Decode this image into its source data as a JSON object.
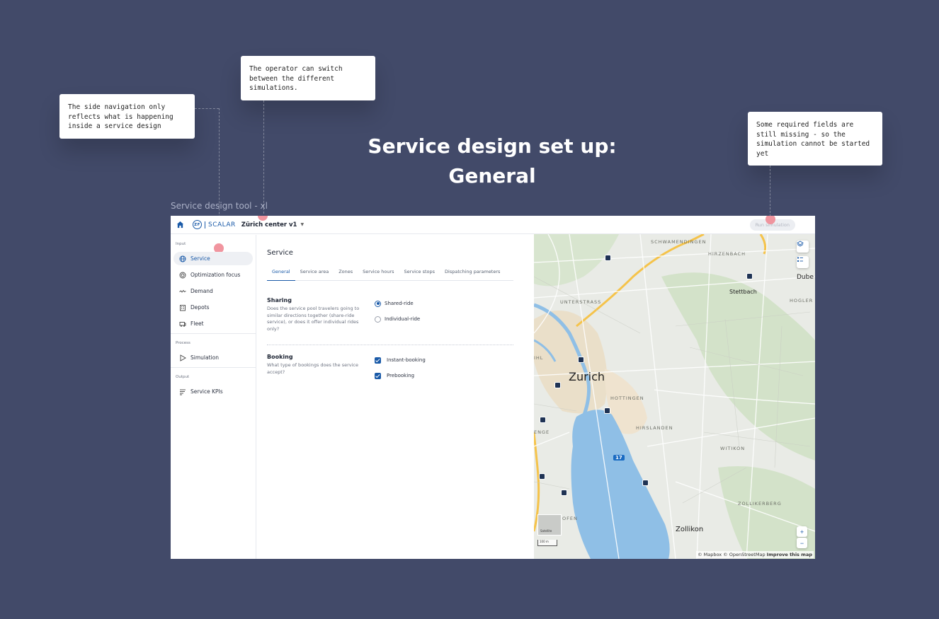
{
  "page": {
    "title_line1": "Service design set up:",
    "title_line2": "General",
    "frame_label": "Service design tool - xl"
  },
  "annotations": {
    "side_nav": "The side navigation only\nreflects what is happening\ninside a service design",
    "switch_sim": "The operator can switch\nbetween the different\nsimulations.",
    "required_fields": "Some required fields are\nstill missing - so the\nsimulation cannot be started\nyet"
  },
  "topbar": {
    "brand_zf": "ZF",
    "brand_name": "SCALAR",
    "simulation_name": "Zürich center v1",
    "run_button": "Run simulation"
  },
  "sidenav": {
    "input_label": "Input",
    "input_items": [
      {
        "label": "Service",
        "icon": "globe-icon"
      },
      {
        "label": "Optimization focus",
        "icon": "target-icon"
      },
      {
        "label": "Demand",
        "icon": "wave-icon"
      },
      {
        "label": "Depots",
        "icon": "building-icon"
      },
      {
        "label": "Fleet",
        "icon": "vehicle-icon"
      }
    ],
    "process_label": "Process",
    "process_items": [
      {
        "label": "Simulation",
        "icon": "play-icon"
      }
    ],
    "output_label": "Output",
    "output_items": [
      {
        "label": "Service KPIs",
        "icon": "list-icon"
      }
    ]
  },
  "content": {
    "heading": "Service",
    "tabs": [
      "General",
      "Service area",
      "Zones",
      "Service hours",
      "Service stops",
      "Dispatching parameters"
    ],
    "sharing": {
      "title": "Sharing",
      "description": "Does the service pool travelers going to similar directions together (share-ride service), or does it offer individual rides only?",
      "options": [
        "Shared-ride",
        "Individual-ride"
      ],
      "selected": "Shared-ride"
    },
    "booking": {
      "title": "Booking",
      "description": "What type of bookings does the service accept?",
      "options": [
        "Instant-booking",
        "Prebooking"
      ],
      "checked": [
        "Instant-booking",
        "Prebooking"
      ]
    }
  },
  "map": {
    "places": {
      "zurich": "Zurich",
      "schwamendingen": "SCHWAMENDINGEN",
      "hirzenbach": "HIRZENBACH",
      "dube": "Dube",
      "stettbach": "Stettbach",
      "hogler": "HOGLER",
      "unterstrass": "UNTERSTRASS",
      "hottingen": "HOTTINGEN",
      "hirslanden": "HIRSLANDEN",
      "witikon": "WITIKON",
      "zollikerberg": "ZOLLIKERBERG",
      "zollikon": "Zollikon",
      "ihl": "IHL",
      "enge": "ENGE",
      "ofen": "OFEN"
    },
    "route_badge": "17",
    "satellite_label": "Satellite",
    "scale_label": "100 m",
    "zoom_in": "+",
    "zoom_out": "−",
    "attribution_prefix": "© Mapbox © OpenStreetMap",
    "attribution_link": "Improve this map",
    "colors": {
      "water": "#8fbfe6",
      "land": "#e9ebe6",
      "park": "#cfdfc5",
      "road_major": "#f5c34a",
      "road": "#ffffff"
    }
  }
}
